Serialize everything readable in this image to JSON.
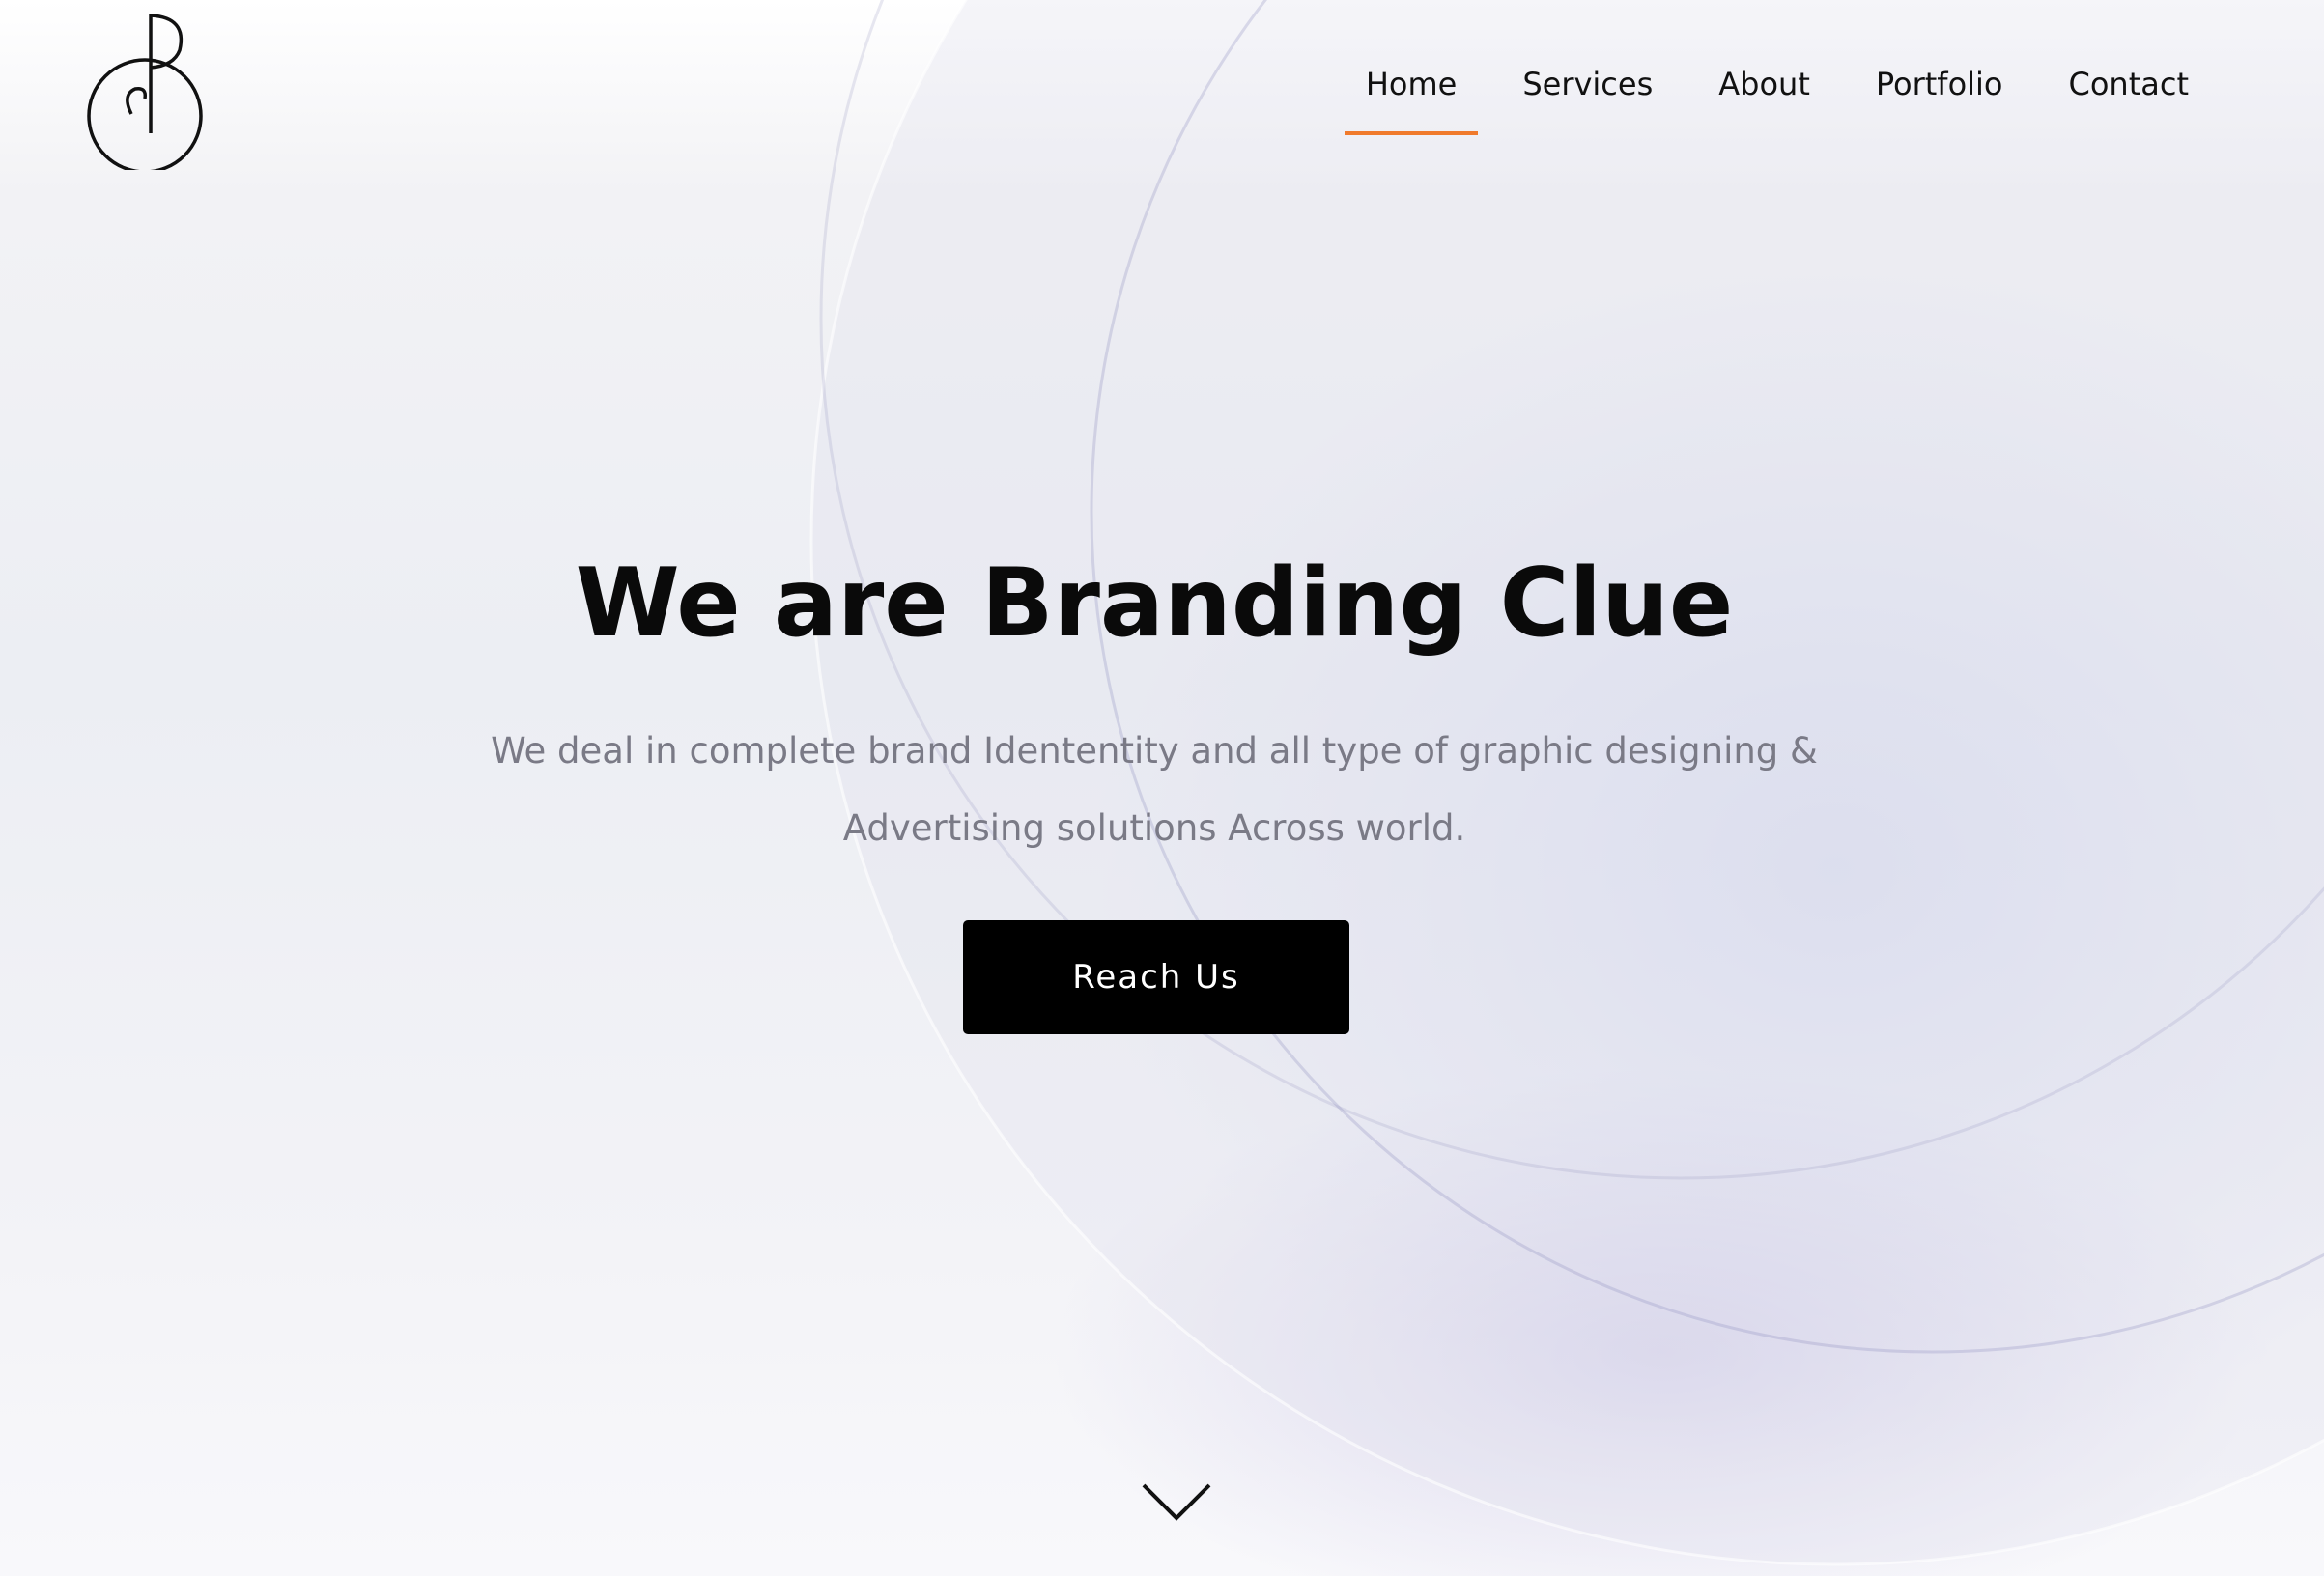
{
  "nav": {
    "items": [
      {
        "label": "Home",
        "active": true
      },
      {
        "label": "Services",
        "active": false
      },
      {
        "label": "About",
        "active": false
      },
      {
        "label": "Portfolio",
        "active": false
      },
      {
        "label": "Contact",
        "active": false
      }
    ],
    "active_color": "#f07a2c"
  },
  "hero": {
    "title": "We are Branding Clue",
    "subtitle_line1": "We deal in complete brand Idententity and all type of graphic designing &",
    "subtitle_line2": "Advertising solutions Across world.",
    "cta_label": "Reach Us"
  },
  "icons": {
    "logo": "cb-monogram-logo",
    "scroll": "chevron-down-icon"
  }
}
